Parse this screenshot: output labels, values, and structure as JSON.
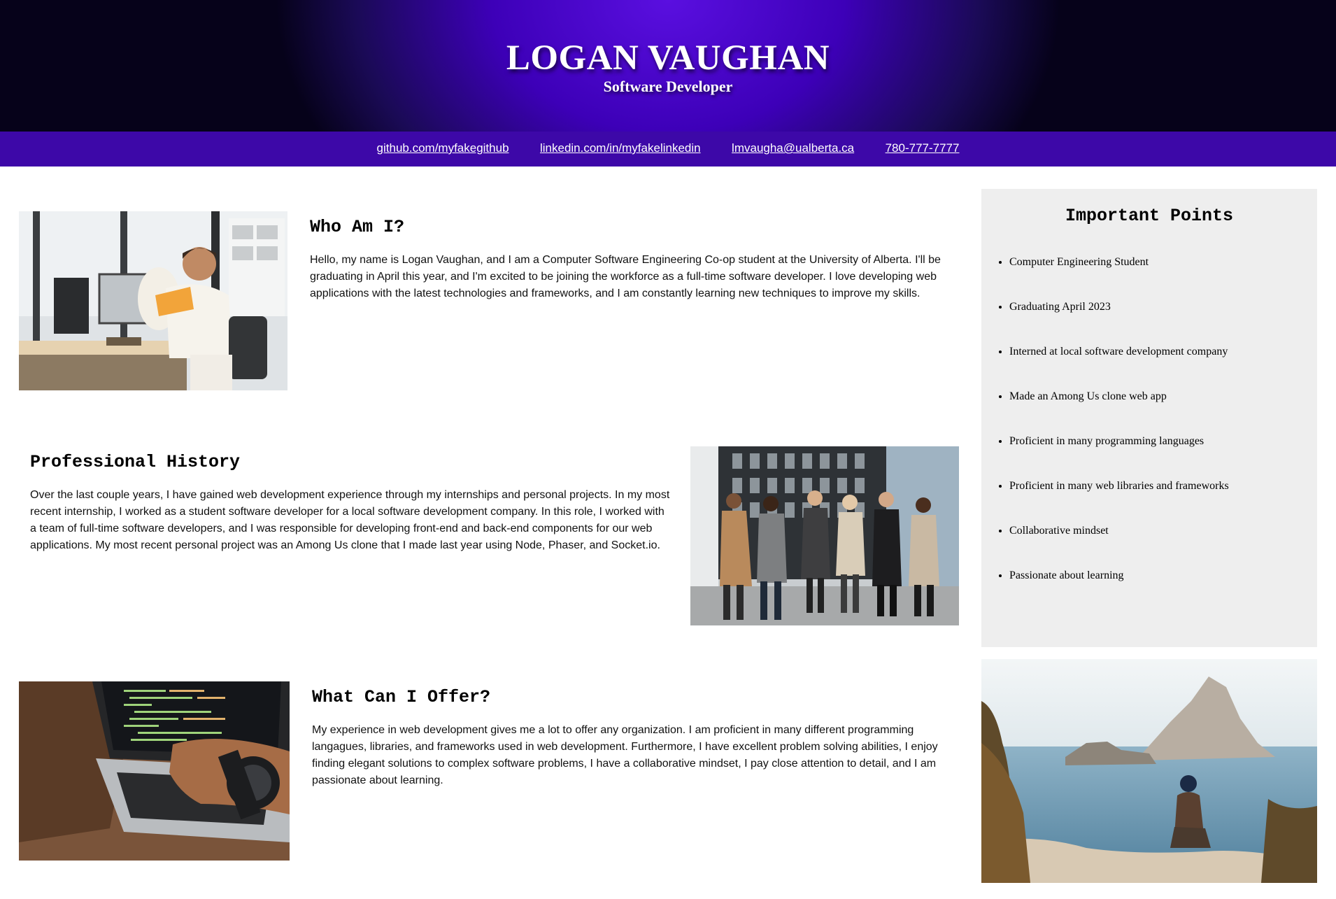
{
  "header": {
    "name": "LOGAN VAUGHAN",
    "role": "Software Developer"
  },
  "contact": {
    "github": "github.com/myfakegithub",
    "linkedin": "linkedin.com/in/myfakelinkedin",
    "email": "lmvaugha@ualberta.ca",
    "phone": "780-777-7777"
  },
  "sections": {
    "who": {
      "title": "Who Am I?",
      "text": "Hello, my name is Logan Vaughan, and I am a Computer Software Engineering Co-op student at the University of Alberta. I'll be graduating in April this year, and I'm excited to be joining the workforce as a full-time software developer. I love developing web applications with the latest technologies and frameworks, and I am constantly learning new techniques to improve my skills."
    },
    "history": {
      "title": "Professional History",
      "text": "Over the last couple years, I have gained web development experience through my internships and personal projects. In my most recent internship, I worked as a student software developer for a local software development company. In this role, I worked with a team of full-time software developers, and I was responsible for developing front-end and back-end components for our web applications. My most recent personal project was an Among Us clone that I made last year using Node, Phaser, and Socket.io."
    },
    "offer": {
      "title": "What Can I Offer?",
      "text": "My experience in web development gives me a lot to offer any organization. I am proficient in many different programming langagues, libraries, and frameworks used in web development. Furthermore, I have excellent problem solving abilities, I enjoy finding elegant solutions to complex software problems, I have a collaborative mindset, I pay close attention to detail, and I am passionate about learning."
    }
  },
  "important_points": {
    "title": "Important Points",
    "items": [
      "Computer Engineering Student",
      "Graduating April 2023",
      "Interned at local software development company",
      "Made an Among Us clone web app",
      "Proficient in many programming languages",
      "Proficient in many web libraries and frameworks",
      "Collaborative mindset",
      "Passionate about learning"
    ]
  }
}
